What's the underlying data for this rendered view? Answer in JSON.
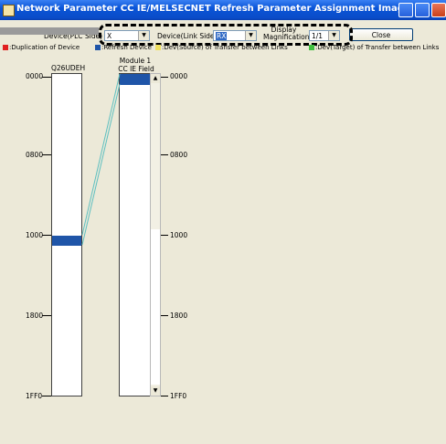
{
  "window": {
    "title": "Network Parameter  CC IE/MELSECNET Refresh Parameter Assignment Image"
  },
  "toolbar": {
    "device_plc_label": "Device(PLC Side)",
    "device_plc_value": "X",
    "device_link_label": "Device(Link Side)",
    "device_link_value": "RX",
    "display_mag_label": "Display Magnification",
    "display_mag_value": "1/1",
    "close_label": "Close"
  },
  "legend": [
    {
      "label": ":Duplication of Device",
      "color": "#e02020"
    },
    {
      "label": ":Refresh Device",
      "color": "#1f55a8"
    },
    {
      "label": ":Dev(Source) of Transfer between Links",
      "color": "#f0e060"
    },
    {
      "label": ":Dev(Target) of Transfer between Links",
      "color": "#40c040"
    }
  ],
  "plc_column": {
    "header": "Q26UDEH",
    "addresses": [
      "0000",
      "0800",
      "1000",
      "1800",
      "1FF0"
    ]
  },
  "module_column": {
    "header_line1": "Module 1",
    "header_line2": "CC IE Field",
    "addresses": [
      "0000",
      "0800",
      "1000",
      "1800",
      "1FF0"
    ]
  }
}
